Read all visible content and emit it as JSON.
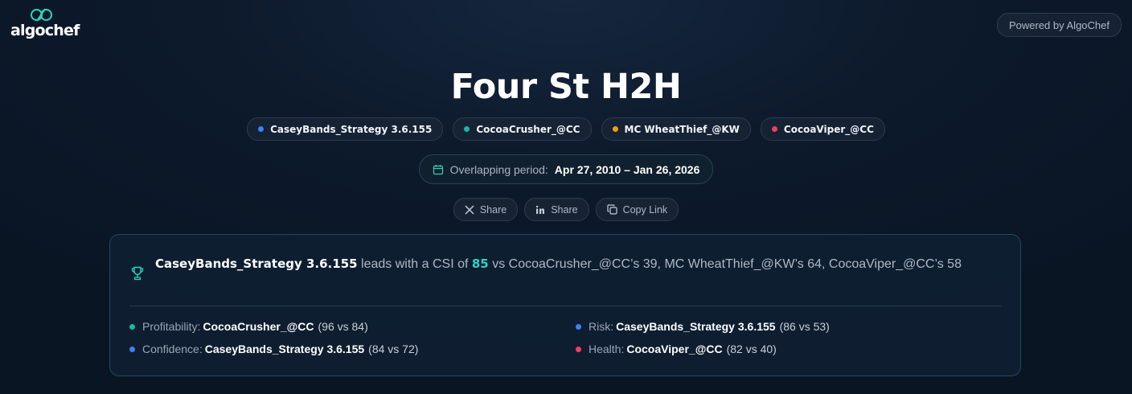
{
  "brand": {
    "name": "algochef",
    "accent": "#2dd4bf"
  },
  "powered_by": "Powered by AlgoChef",
  "title": "Four St H2H",
  "strategies": [
    {
      "name": "CaseyBands_Strategy 3.6.155",
      "color": "#3b82f6"
    },
    {
      "name": "CocoaCrusher_@CC",
      "color": "#14b8a6"
    },
    {
      "name": "MC WheatThief_@KW",
      "color": "#f59e0b"
    },
    {
      "name": "CocoaViper_@CC",
      "color": "#f43f5e"
    }
  ],
  "period": {
    "label": "Overlapping period:",
    "value": "Apr 27, 2010 – Jan 26, 2026"
  },
  "share": {
    "x_label": "Share",
    "linkedin_label": "Share",
    "copy_label": "Copy Link"
  },
  "summary": {
    "leader": "CaseyBands_Strategy 3.6.155",
    "text_before": " leads with a CSI of ",
    "csi": "85",
    "text_after": " vs CocoaCrusher_@CC’s 39, MC WheatThief_@KW’s 64, CocoaViper_@CC’s 58"
  },
  "categories": [
    {
      "label": "Profitability:",
      "winner": "CocoaCrusher_@CC",
      "scores": "(96 vs 84)",
      "color": "#14b8a6"
    },
    {
      "label": "Risk:",
      "winner": "CaseyBands_Strategy 3.6.155",
      "scores": "(86 vs 53)",
      "color": "#3b82f6"
    },
    {
      "label": "Confidence:",
      "winner": "CaseyBands_Strategy 3.6.155",
      "scores": "(84 vs 72)",
      "color": "#3b82f6"
    },
    {
      "label": "Health:",
      "winner": "CocoaViper_@CC",
      "scores": "(82 vs 40)",
      "color": "#f43f5e"
    }
  ],
  "icons": [
    "logo-mark-icon",
    "calendar-icon",
    "x-icon",
    "linkedin-icon",
    "copy-icon",
    "trophy-icon"
  ]
}
